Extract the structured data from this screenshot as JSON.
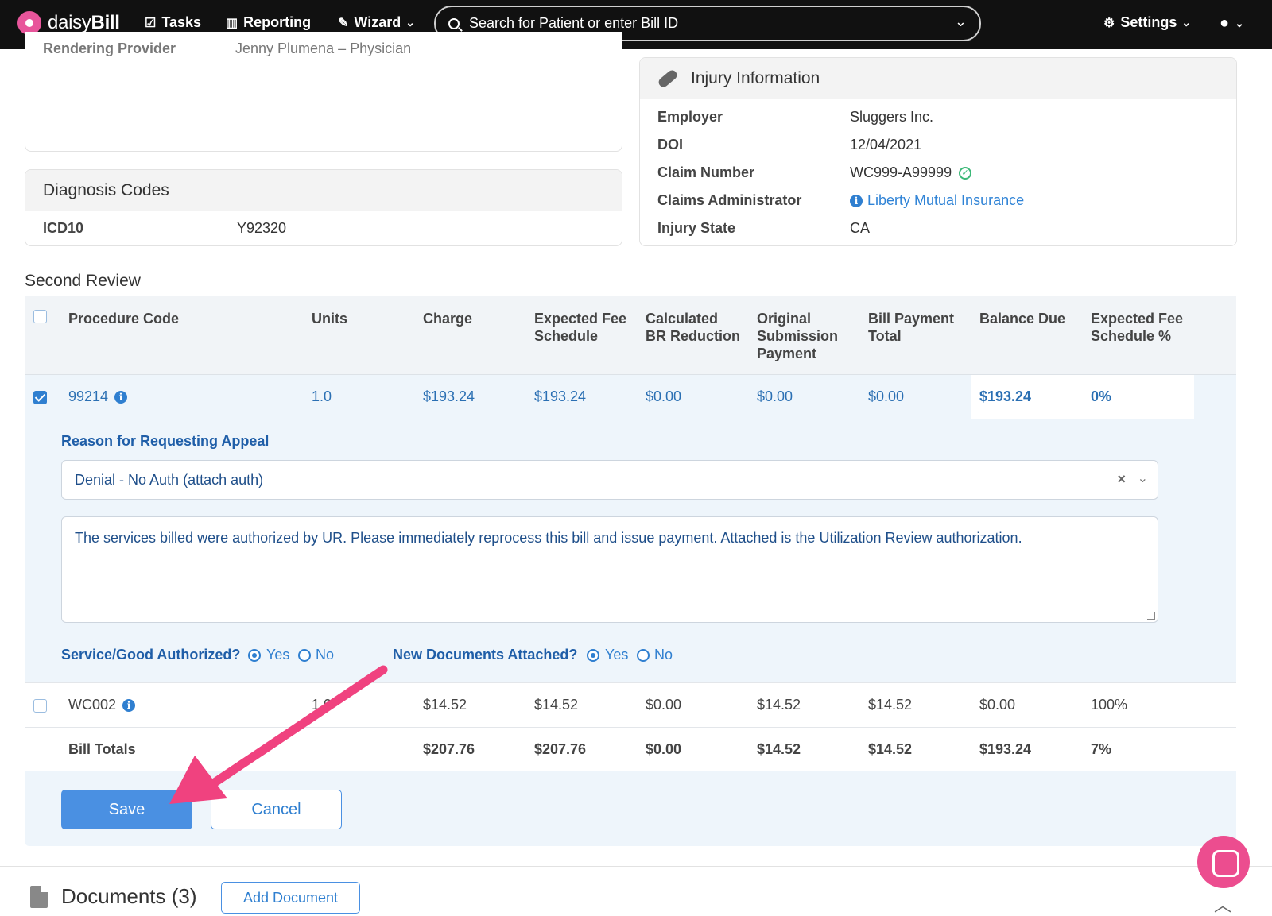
{
  "nav": {
    "brand_prefix": "daisy",
    "brand_suffix": "Bill",
    "tasks": "Tasks",
    "reporting": "Reporting",
    "wizard": "Wizard",
    "search_placeholder": "Search for Patient or enter Bill ID",
    "settings": "Settings"
  },
  "rendering": {
    "label": "Rendering Provider",
    "value": "Jenny Plumena – Physician"
  },
  "diagnosis": {
    "title": "Diagnosis Codes",
    "code_type": "ICD10",
    "code": "Y92320"
  },
  "injury": {
    "title": "Injury Information",
    "rows": [
      {
        "label": "Employer",
        "value": "Sluggers Inc."
      },
      {
        "label": "DOI",
        "value": "12/04/2021"
      },
      {
        "label": "Claim Number",
        "value": "WC999-A99999"
      },
      {
        "label": "Claims Administrator",
        "value": "Liberty Mutual Insurance"
      },
      {
        "label": "Injury State",
        "value": "CA"
      }
    ]
  },
  "second_review": {
    "title": "Second Review",
    "headers": {
      "procedure_code": "Procedure Code",
      "units": "Units",
      "charge": "Charge",
      "expected_fee_1": "Expected Fee",
      "expected_fee_2": "Schedule",
      "calc_br_1": "Calculated",
      "calc_br_2": "BR Reduction",
      "orig_1": "Original",
      "orig_2": "Submission",
      "orig_3": "Payment",
      "bill_pay_1": "Bill Payment",
      "bill_pay_2": "Total",
      "balance_due": "Balance Due",
      "efs_pct_1": "Expected Fee",
      "efs_pct_2": "Schedule %"
    },
    "rows": [
      {
        "code": "99214",
        "units": "1.0",
        "charge": "$193.24",
        "expected_fee": "$193.24",
        "calc_br": "$0.00",
        "orig_payment": "$0.00",
        "bill_payment": "$0.00",
        "balance_due": "$193.24",
        "efs_pct": "0%",
        "checked": true
      },
      {
        "code": "WC002",
        "units": "1.0",
        "charge": "$14.52",
        "expected_fee": "$14.52",
        "calc_br": "$0.00",
        "orig_payment": "$14.52",
        "bill_payment": "$14.52",
        "balance_due": "$0.00",
        "efs_pct": "100%",
        "checked": false
      }
    ],
    "totals": {
      "label": "Bill Totals",
      "charge": "$207.76",
      "expected_fee": "$207.76",
      "calc_br": "$0.00",
      "orig_payment": "$14.52",
      "bill_payment": "$14.52",
      "balance_due": "$193.24",
      "efs_pct": "7%"
    },
    "appeal": {
      "label": "Reason for Requesting Appeal",
      "selected": "Denial - No Auth (attach auth)",
      "text": "The services billed were authorized by UR. Please immediately reprocess this bill and issue payment. Attached is the Utilization Review authorization."
    },
    "authorized": {
      "label": "Service/Good Authorized?",
      "yes": "Yes",
      "no": "No",
      "value": "Yes"
    },
    "new_docs": {
      "label": "New Documents Attached?",
      "yes": "Yes",
      "no": "No",
      "value": "Yes"
    },
    "save": "Save",
    "cancel": "Cancel"
  },
  "documents": {
    "title": "Documents (3)",
    "add": "Add Document"
  },
  "colors": {
    "accent": "#2f7fd0",
    "annotation_arrow": "#f0427f",
    "nav_bg": "#111111"
  }
}
